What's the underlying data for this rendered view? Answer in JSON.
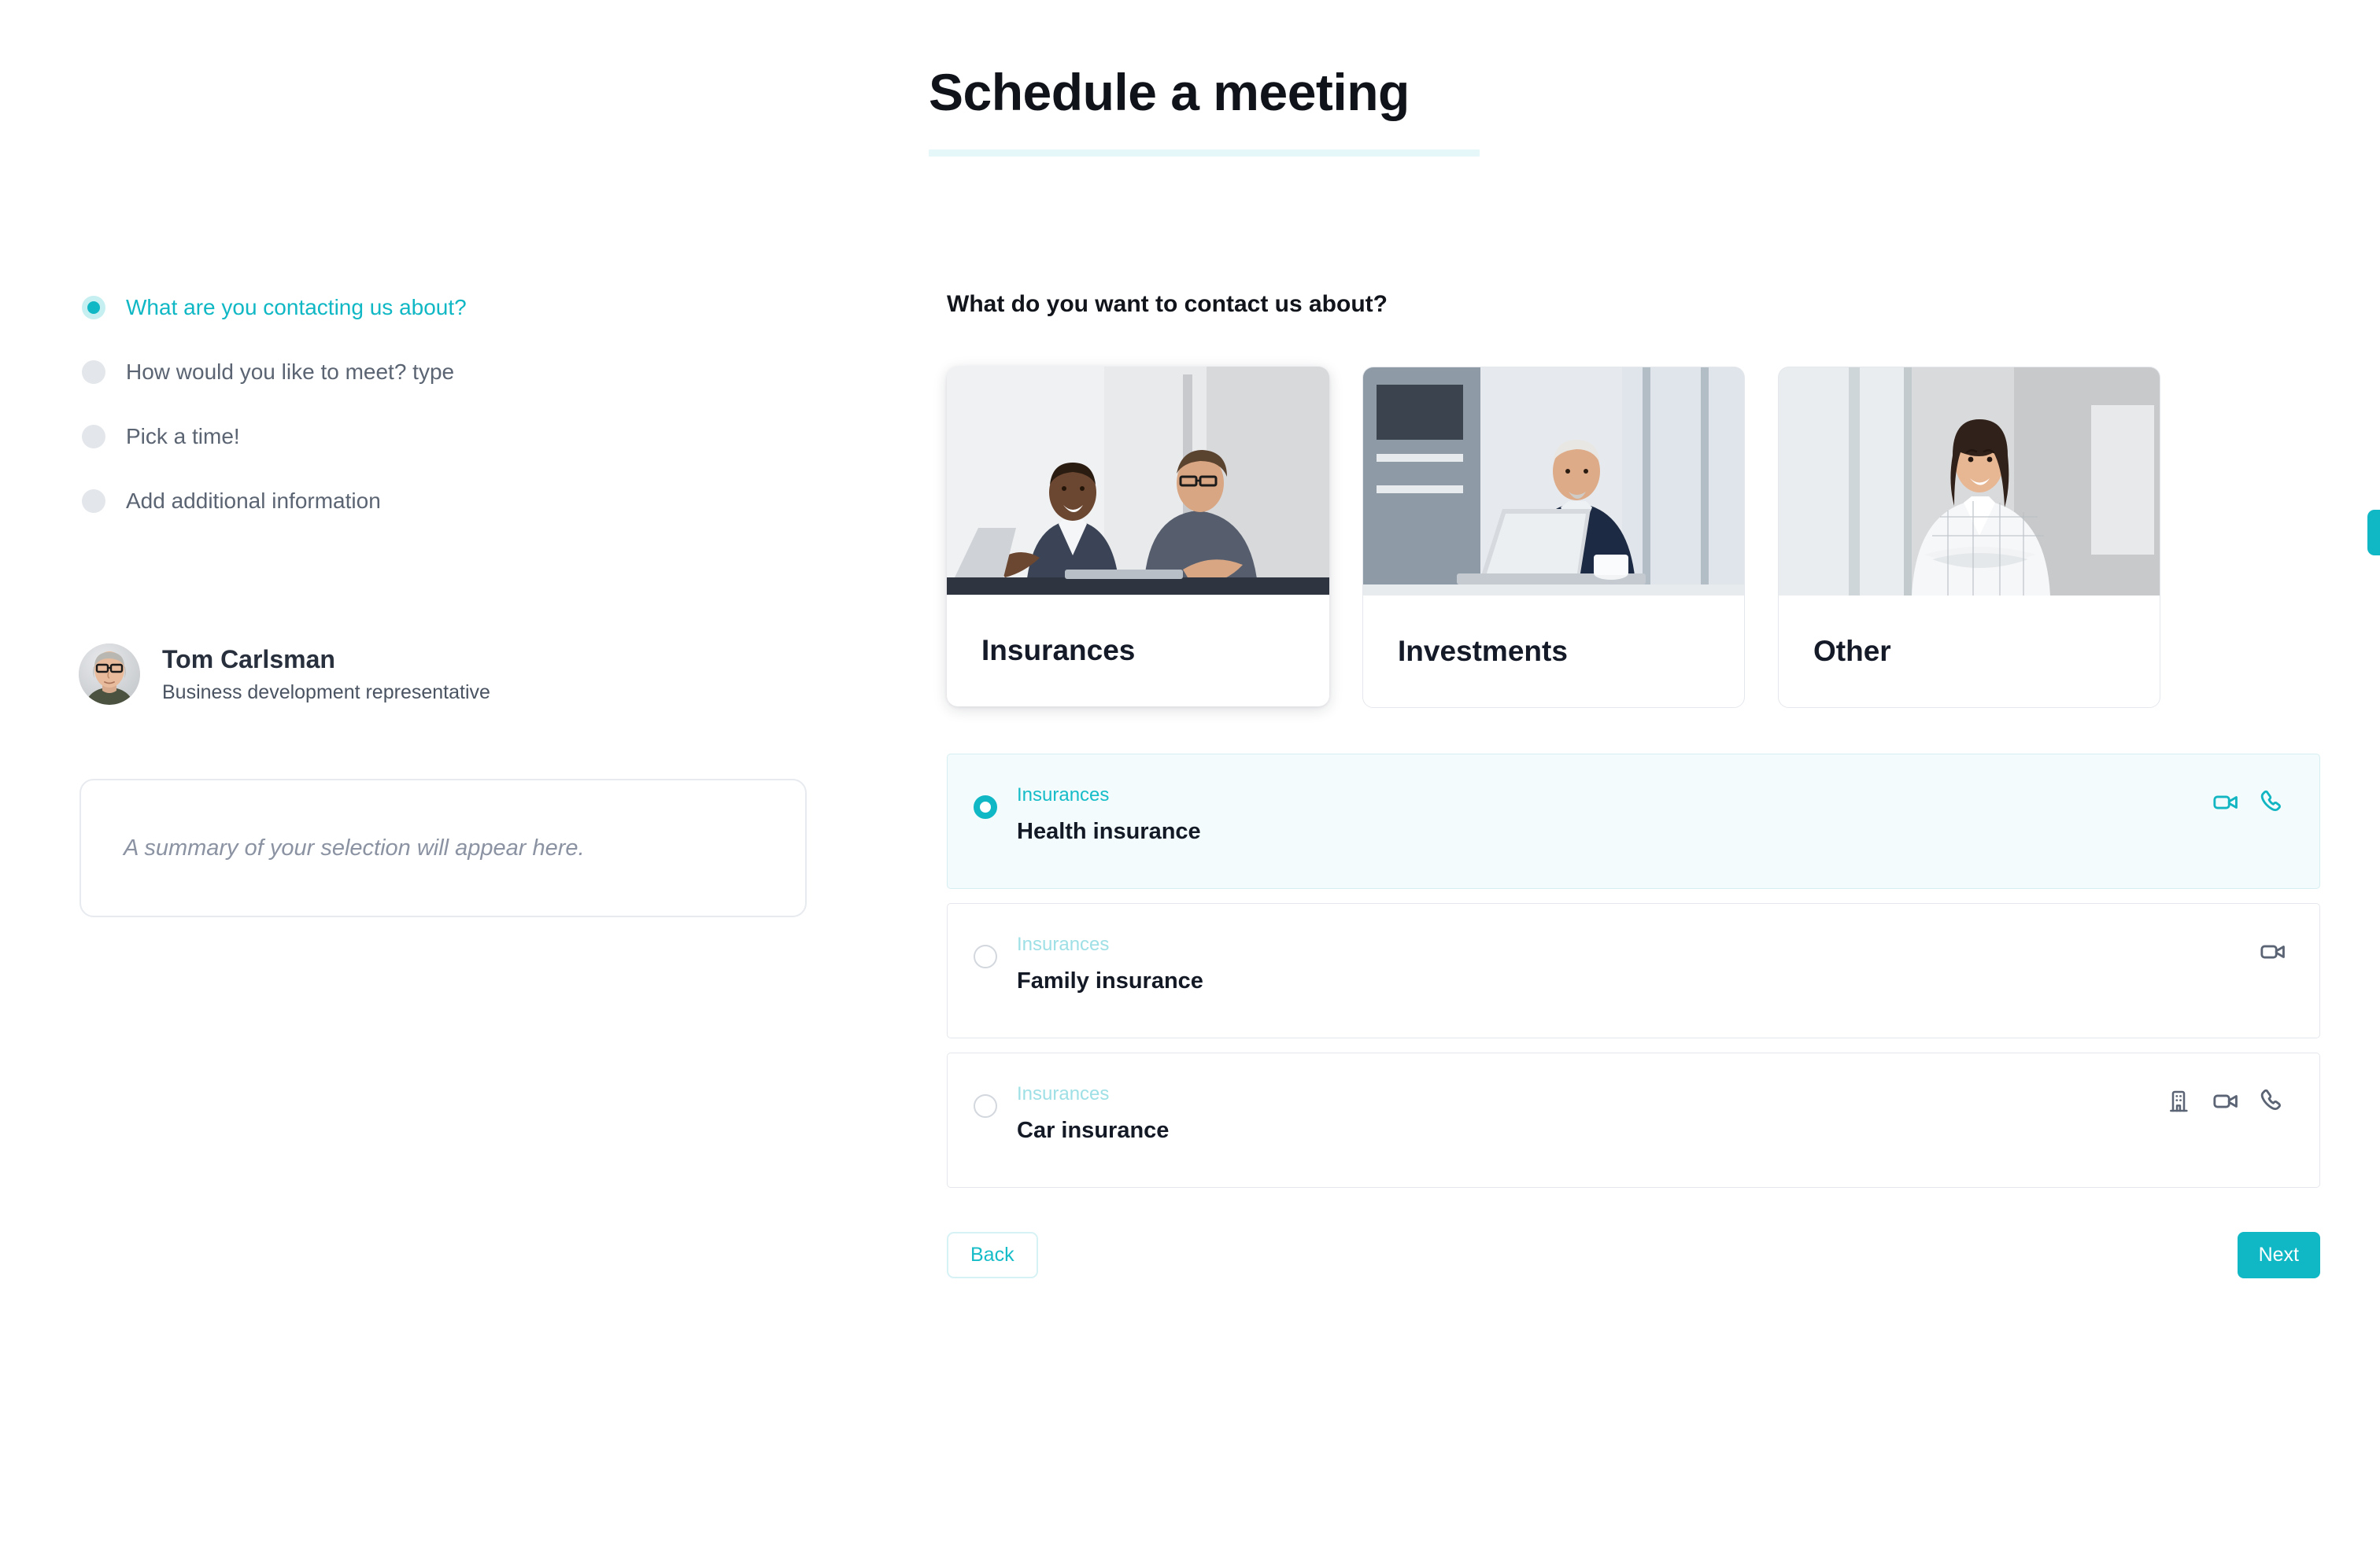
{
  "header": {
    "title": "Schedule a meeting",
    "accent_color": "#10b7c4",
    "underline_color": "#e6f7fa"
  },
  "sidebar": {
    "steps": [
      {
        "label": "What are you contacting us about?",
        "state": "active"
      },
      {
        "label": "How would you like to meet? type",
        "state": "inactive"
      },
      {
        "label": "Pick a time!",
        "state": "inactive"
      },
      {
        "label": "Add additional information",
        "state": "inactive"
      }
    ],
    "profile": {
      "name": "Tom Carlsman",
      "role": "Business development representative",
      "avatar_icon": "avatar-photo"
    },
    "summary": {
      "placeholder": "A summary of your selection will appear here."
    }
  },
  "main": {
    "question": "What do you want to contact us about?",
    "cards": [
      {
        "label": "Insurances",
        "selected": true,
        "photo": "two-businessmen-talking"
      },
      {
        "label": "Investments",
        "selected": false,
        "photo": "businessman-with-laptop"
      },
      {
        "label": "Other",
        "selected": false,
        "photo": "smiling-businesswoman"
      }
    ],
    "cards_next_arrow": "arrow-right-icon",
    "options": [
      {
        "category": "Insurances",
        "title": "Health insurance",
        "selected": true,
        "icons": [
          "video-icon",
          "phone-icon"
        ]
      },
      {
        "category": "Insurances",
        "title": "Family insurance",
        "selected": false,
        "icons": [
          "video-icon"
        ]
      },
      {
        "category": "Insurances",
        "title": "Car insurance",
        "selected": false,
        "icons": [
          "office-icon",
          "video-icon",
          "phone-icon"
        ]
      }
    ],
    "footer": {
      "back_label": "Back",
      "next_label": "Next"
    }
  }
}
